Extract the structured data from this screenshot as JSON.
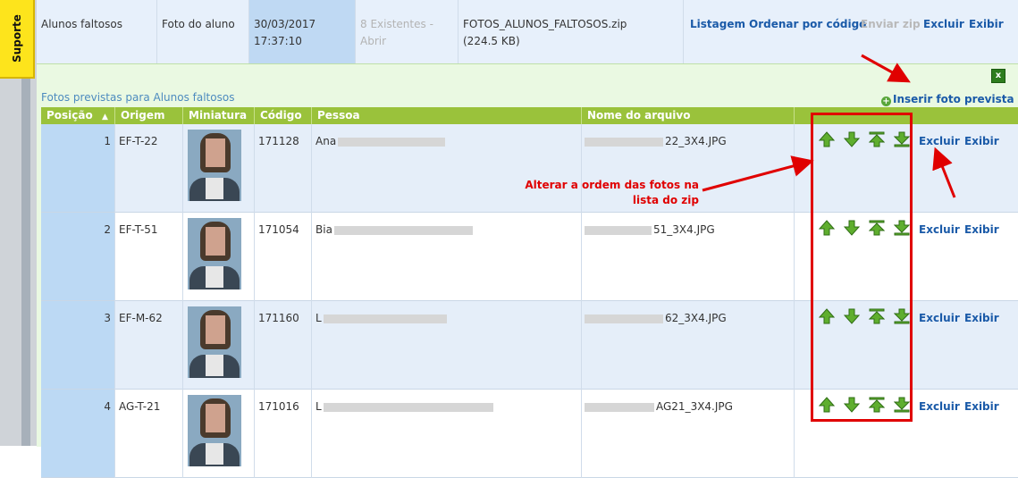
{
  "support_tab": {
    "label": "Suporte"
  },
  "top_row": {
    "name": "Alunos faltosos",
    "type": "Foto do aluno",
    "date": "30/03/2017",
    "time": "17:37:10",
    "existing": "8 Existentes -",
    "existing_open": "Abrir",
    "file": "FOTOS_ALUNOS_FALTOSOS.zip",
    "size": "(224.5 KB)",
    "actions": {
      "listagem": "Listagem",
      "ordenar": "Ordenar por código",
      "enviar": "Enviar zip",
      "excluir": "Excluir",
      "exibir": "Exibir"
    }
  },
  "panel": {
    "close_label": "x",
    "title": "Fotos previstas para Alunos faltosos",
    "insert_label": "Inserir foto prevista"
  },
  "table": {
    "headers": {
      "posicao": "Posição",
      "origem": "Origem",
      "miniatura": "Miniatura",
      "codigo": "Código",
      "pessoa": "Pessoa",
      "arquivo": "Nome do arquivo"
    },
    "rows": [
      {
        "pos": "1",
        "origem": "EF-T-22",
        "codigo": "171128",
        "pessoa": "Ana",
        "arquivo": "22_3X4.JPG",
        "excluir": "Excluir",
        "exibir": "Exibir"
      },
      {
        "pos": "2",
        "origem": "EF-T-51",
        "codigo": "171054",
        "pessoa": "Bia",
        "arquivo": "51_3X4.JPG",
        "excluir": "Excluir",
        "exibir": "Exibir"
      },
      {
        "pos": "3",
        "origem": "EF-M-62",
        "codigo": "171160",
        "pessoa": "L",
        "arquivo": "62_3X4.JPG",
        "excluir": "Excluir",
        "exibir": "Exibir"
      },
      {
        "pos": "4",
        "origem": "AG-T-21",
        "codigo": "171016",
        "pessoa": "L",
        "arquivo": "AG21_3X4.JPG",
        "excluir": "Excluir",
        "exibir": "Exibir"
      }
    ]
  },
  "annotation": {
    "line1": "Alterar a ordem das fotos na",
    "line2": "lista do zip",
    "color": "#e00000"
  },
  "icons": [
    "arrow-up-icon",
    "arrow-down-icon",
    "arrow-top-icon",
    "arrow-bottom-icon",
    "sort-asc-icon",
    "plus-circle-icon"
  ]
}
